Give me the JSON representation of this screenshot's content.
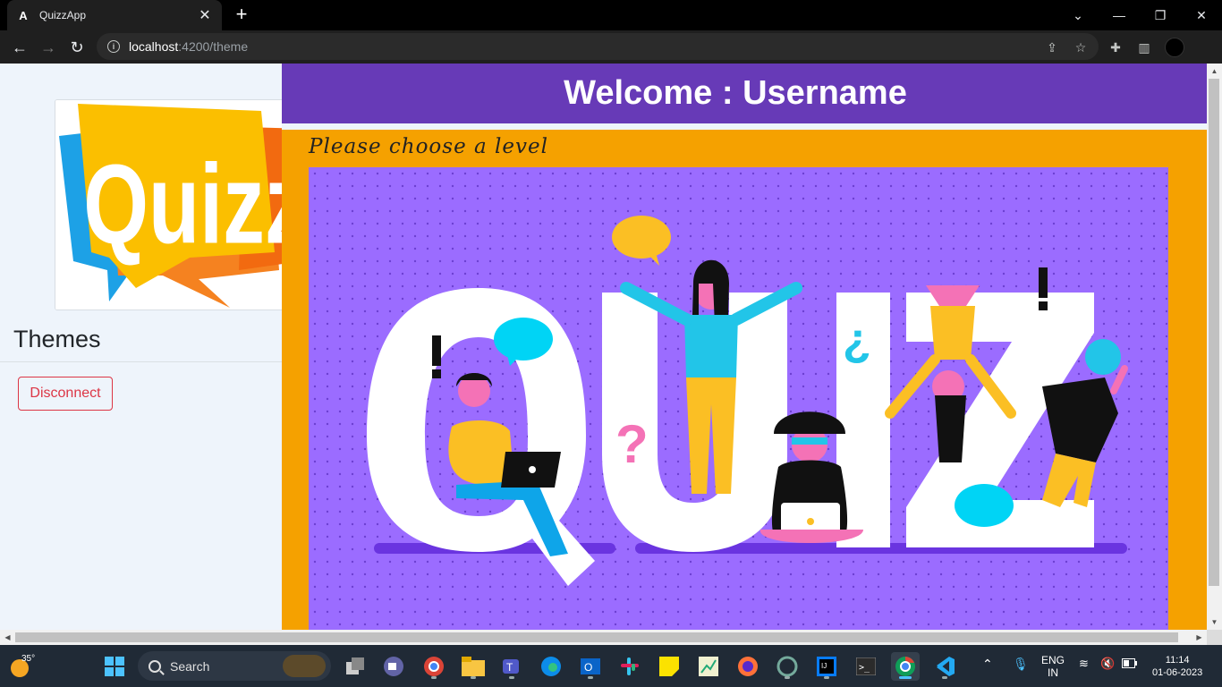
{
  "browser": {
    "tab_title": "QuizzApp",
    "tab_favicon": "A",
    "url_host": "localhost",
    "url_path": ":4200/theme",
    "new_tab": "+",
    "close_tab": "✕"
  },
  "sidebar": {
    "logo_text": "Quizz",
    "themes_title": "Themes",
    "disconnect_label": "Disconnect"
  },
  "main": {
    "welcome": "Welcome : Username",
    "choose_level": "Please choose a level",
    "art_text": "QUIZ"
  },
  "taskbar": {
    "temperature": "35°",
    "search_label": "Search",
    "lang_line1": "ENG",
    "lang_line2": "IN",
    "time": "11:14",
    "date": "01-06-2023"
  },
  "colors": {
    "header_purple": "#673ab7",
    "main_orange": "#f5a100",
    "disconnect_red": "#dc3545",
    "art_purple": "#9b6cff"
  }
}
